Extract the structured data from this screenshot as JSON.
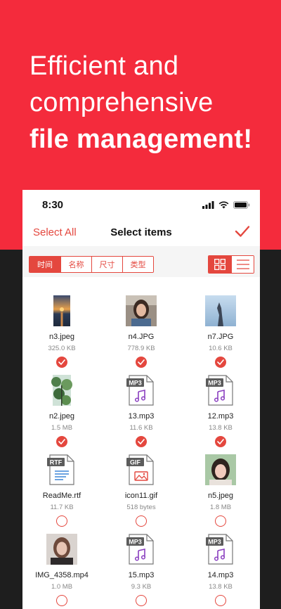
{
  "hero": {
    "line1": "Efficient and",
    "line2": "comprehensive",
    "line3": "file management!"
  },
  "status_bar": {
    "time": "8:30"
  },
  "navbar": {
    "select_all": "Select All",
    "title": "Select items"
  },
  "sort_tabs": [
    "时间",
    "名称",
    "尺寸",
    "类型"
  ],
  "colors": {
    "accent": "#e4473e",
    "hero": "#f42b3c"
  },
  "files": [
    {
      "name": "n3.jpeg",
      "size": "325.0 KB",
      "kind": "photo-sunset",
      "selected": true
    },
    {
      "name": "n4.JPG",
      "size": "778.9 KB",
      "kind": "photo-woman",
      "selected": true
    },
    {
      "name": "n7.JPG",
      "size": "10.6 KB",
      "kind": "photo-sky",
      "selected": true
    },
    {
      "name": "n2.jpeg",
      "size": "1.5 MB",
      "kind": "photo-forest",
      "selected": true
    },
    {
      "name": "13.mp3",
      "size": "11.6 KB",
      "kind": "MP3",
      "selected": true
    },
    {
      "name": "12.mp3",
      "size": "13.8 KB",
      "kind": "MP3",
      "selected": true
    },
    {
      "name": "ReadMe.rtf",
      "size": "11.7 KB",
      "kind": "RTF",
      "selected": false
    },
    {
      "name": "icon11.gif",
      "size": "518 bytes",
      "kind": "GIF",
      "selected": false
    },
    {
      "name": "n5.jpeg",
      "size": "1.8 MB",
      "kind": "photo-girl",
      "selected": false
    },
    {
      "name": "IMG_4358.mp4",
      "size": "1.0 MB",
      "kind": "photo-portrait",
      "selected": false
    },
    {
      "name": "15.mp3",
      "size": "9.3 KB",
      "kind": "MP3",
      "selected": false
    },
    {
      "name": "14.mp3",
      "size": "13.8 KB",
      "kind": "MP3",
      "selected": false
    }
  ]
}
